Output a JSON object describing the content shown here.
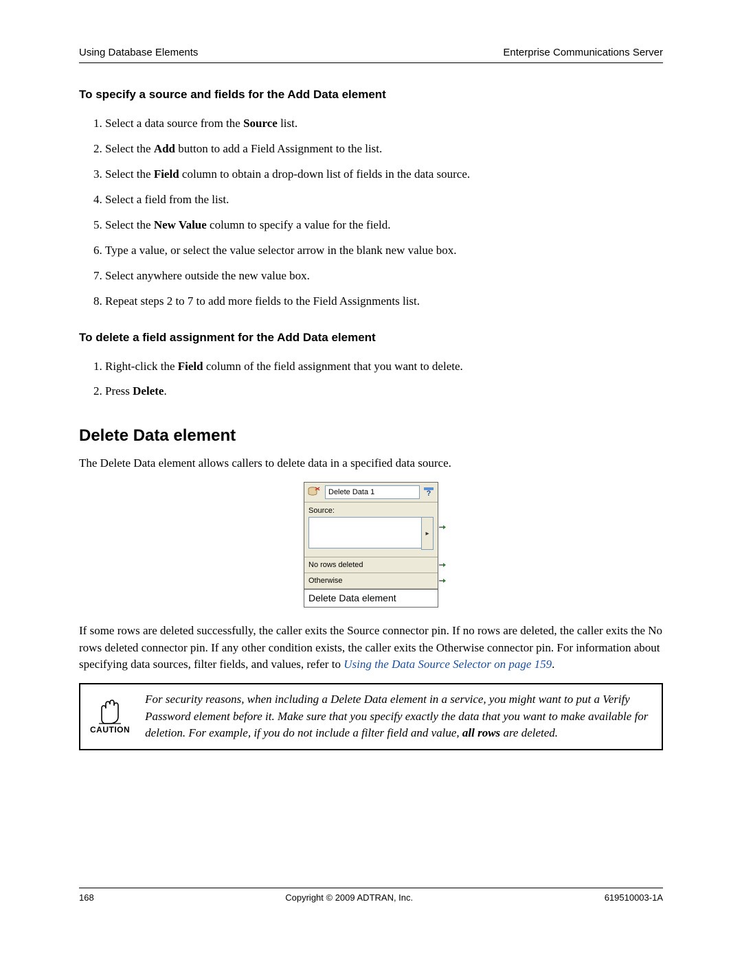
{
  "header": {
    "left": "Using Database Elements",
    "right": "Enterprise Communications Server"
  },
  "sec1": {
    "title": "To specify a source and fields for the Add Data element",
    "steps": [
      {
        "pre": "Select a data source from the ",
        "bold": "Source",
        "post": " list."
      },
      {
        "pre": "Select the ",
        "bold": "Add",
        "post": " button to add a Field Assignment to the list."
      },
      {
        "pre": "Select the ",
        "bold": "Field",
        "post": " column to obtain a drop-down list of fields in the data source."
      },
      {
        "pre": "Select a field from the list.",
        "bold": "",
        "post": ""
      },
      {
        "pre": "Select the ",
        "bold": "New Value",
        "post": " column to specify a value for the field."
      },
      {
        "pre": "Type a value, or select the value selector arrow in the blank new value box.",
        "bold": "",
        "post": ""
      },
      {
        "pre": "Select anywhere outside the new value box.",
        "bold": "",
        "post": ""
      },
      {
        "pre": "Repeat steps 2 to 7 to add more fields to the Field Assignments list.",
        "bold": "",
        "post": ""
      }
    ]
  },
  "sec2": {
    "title": "To delete a field assignment for the Add Data element",
    "steps": [
      {
        "pre": "Right-click the ",
        "bold": "Field",
        "post": " column of the field assignment that you want to delete."
      },
      {
        "pre": "Press ",
        "bold": "Delete",
        "post": "."
      }
    ]
  },
  "heading": "Delete Data element",
  "intro": "The Delete Data element allows callers to delete data in a specified data source.",
  "figure": {
    "title_value": "Delete Data 1",
    "source_label": "Source:",
    "row_no": "No rows deleted",
    "row_otherwise": "Otherwise",
    "caption": "Delete Data element"
  },
  "para2_a": "If some rows are deleted successfully, the caller exits the Source connector pin. If no rows are deleted, the caller exits the No rows deleted connector pin. If any other condition exists, the caller exits the Otherwise connector pin. For information about specifying data sources, filter fields, and values, refer to ",
  "para2_link": "Using the Data Source Selector on page 159",
  "para2_b": ".",
  "caution": {
    "label": "CAUTION",
    "text_a": "For security reasons, when including a Delete Data element in a service, you might want to put a Verify Password element before it. Make sure that you specify exactly the data that you want to make available for deletion. For example, if you do not include a filter field and value, ",
    "bold": "all rows",
    "text_b": " are deleted."
  },
  "footer": {
    "page": "168",
    "center": "Copyright © 2009 ADTRAN, Inc.",
    "right": "619510003-1A"
  }
}
